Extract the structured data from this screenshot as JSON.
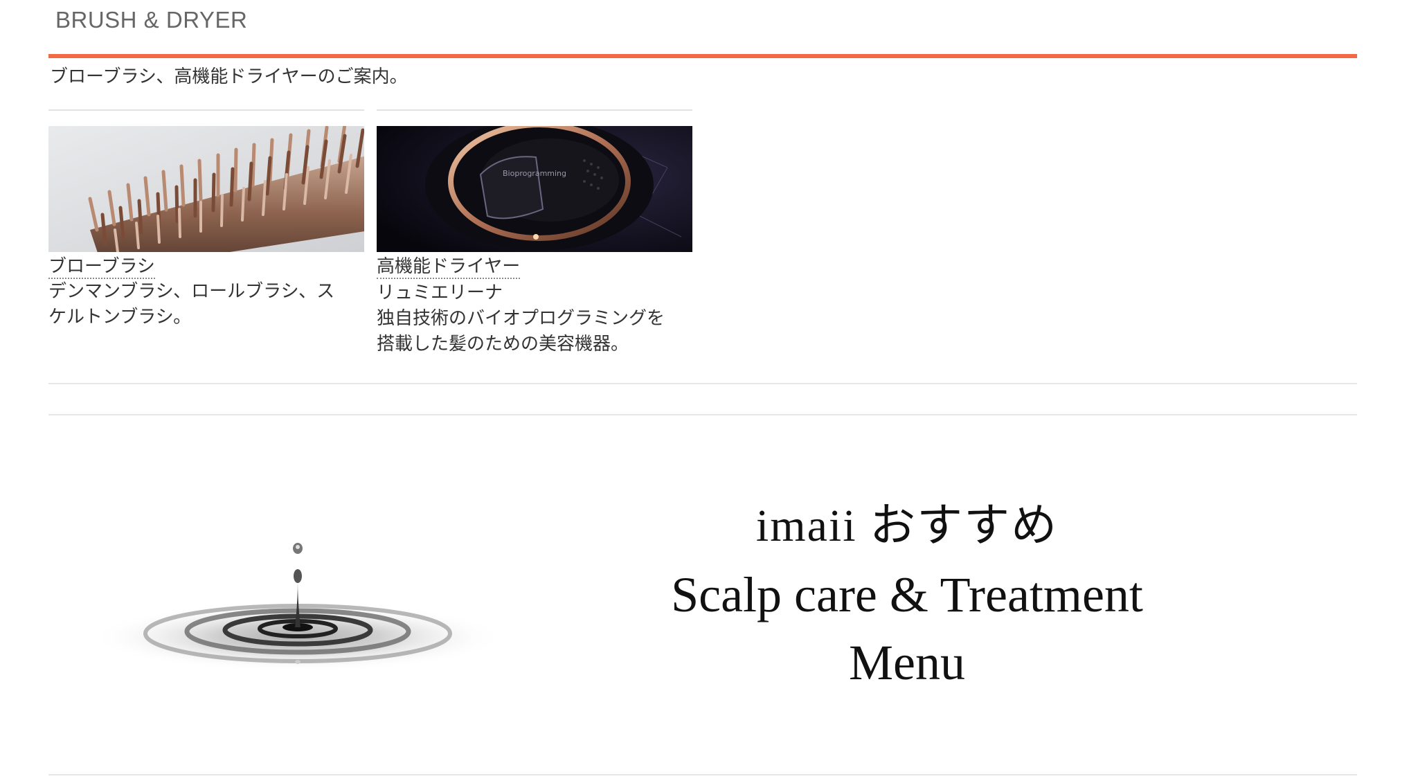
{
  "section": {
    "title": "BRUSH & DRYER",
    "description": "ブローブラシ、高機能ドライヤーのご案内。",
    "accent_color": "#f26a45"
  },
  "cards": [
    {
      "title": "ブローブラシ",
      "subtitle": "",
      "text_line1": "デンマンブラシ、ロールブラシ、ス",
      "text_line2": "ケルトンブラシ。",
      "image_icon": "brush-photo"
    },
    {
      "title": "高機能ドライヤー",
      "subtitle": "リュミエリーナ",
      "text_line1": "独自技術のバイオプログラミングを",
      "text_line2": "搭載した髪のための美容機器。",
      "image_label": "Bioprogramming",
      "image_icon": "dryer-photo"
    }
  ],
  "banner": {
    "line1": "imaii おすすめ",
    "line2": "Scalp care & Treatment",
    "line3": "Menu",
    "image_icon": "water-drop-ripple"
  }
}
